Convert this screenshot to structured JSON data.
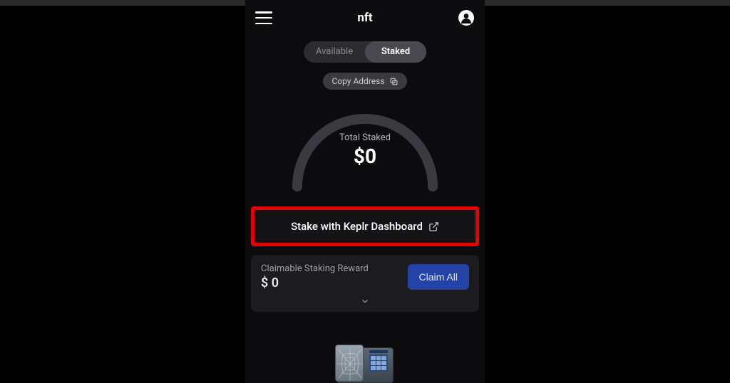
{
  "header": {
    "title": "nft"
  },
  "tabs": {
    "available": "Available",
    "staked": "Staked"
  },
  "copy_address": "Copy Address",
  "total_staked": {
    "label": "Total Staked",
    "value": "$0"
  },
  "stake_button": "Stake with Keplr Dashboard",
  "reward": {
    "label": "Claimable Staking Reward",
    "value": "$ 0",
    "claim_label": "Claim All"
  }
}
